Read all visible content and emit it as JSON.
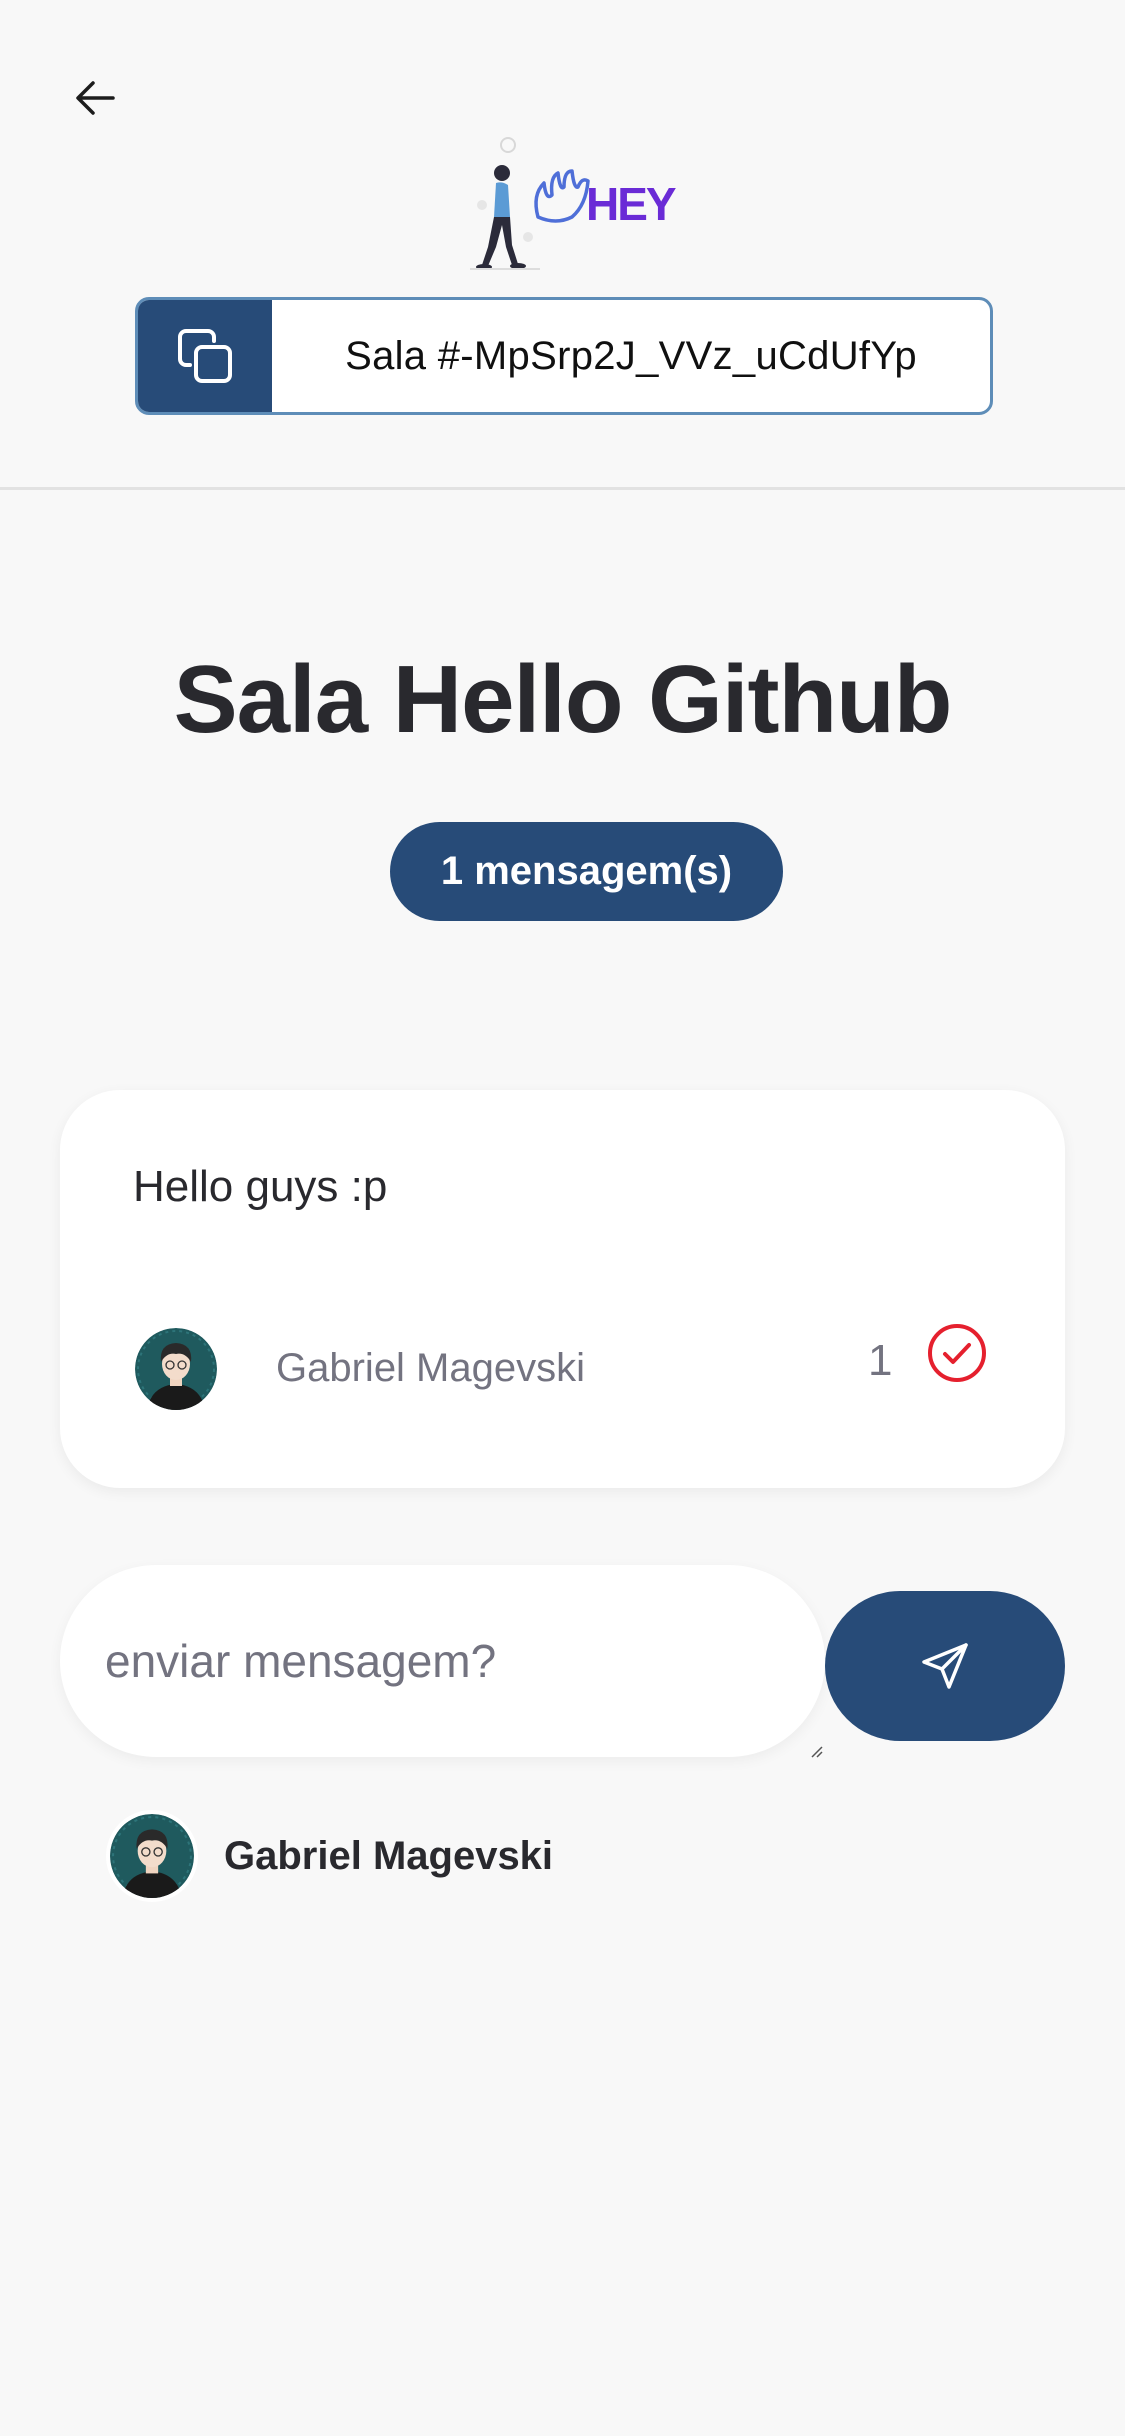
{
  "header": {
    "room_code_text": "Sala #-MpSrp2J_VVz_uCdUfYp",
    "logo_text": "HEY",
    "icons": {
      "back": "arrow-left-icon",
      "copy": "copy-icon"
    }
  },
  "room": {
    "title": "Sala Hello Github",
    "message_count": "1 mensagem(s)"
  },
  "questions": [
    {
      "content": "Hello guys :p",
      "author": "Gabriel Magevski",
      "like_count": "1",
      "icons": {
        "like": "check-circle-icon",
        "avatar": "avatar-image"
      }
    }
  ],
  "form": {
    "placeholder": "enviar mensagem?",
    "value": "",
    "icons": {
      "send": "send-icon"
    }
  },
  "user": {
    "name": "Gabriel Magevski"
  },
  "colors": {
    "primary": "#274b78",
    "accent_border": "#5e8db8",
    "logo_purple": "#6a2bd6",
    "like_red": "#e5202e",
    "background": "#f8f8f8"
  }
}
